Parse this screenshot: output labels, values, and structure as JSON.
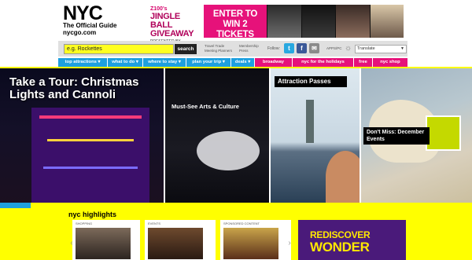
{
  "header": {
    "logo_text": "NYC",
    "logo_subtitle": "The Official Guide",
    "logo_site": "nycgo.com",
    "banner": {
      "station": "Z100's",
      "event_title": "JINGLE BALL GIVEAWAY",
      "presented_by": "PRESENTED BY",
      "cta": "ENTER TO WIN 2 TICKETS"
    }
  },
  "search": {
    "value": "e.g. Rockettes",
    "button_label": "search"
  },
  "top_links": [
    {
      "label": "Travel Trade"
    },
    {
      "label": "Meeting Planners"
    },
    {
      "label": "Membership"
    },
    {
      "label": "Press"
    }
  ],
  "social": {
    "follow_label": "Follow:",
    "twitter": "t",
    "facebook": "f",
    "email": "✉"
  },
  "apps_label": "APPS/PC",
  "translate": {
    "label": "Translate"
  },
  "nav": [
    {
      "label": "top attractions",
      "dropdown": true
    },
    {
      "label": "what to do",
      "dropdown": true
    },
    {
      "label": "where to stay",
      "dropdown": true
    },
    {
      "label": "plan your trip",
      "dropdown": true
    },
    {
      "label": "deals",
      "dropdown": true
    },
    {
      "label": "broadway",
      "dropdown": false
    },
    {
      "label": "nyc for the holidays",
      "dropdown": false
    },
    {
      "label": "free",
      "dropdown": false
    },
    {
      "label": "nyc shop",
      "dropdown": false
    }
  ],
  "hero": [
    {
      "title": "Take a Tour: Christmas Lights and Cannoli"
    },
    {
      "title": "Must-See Arts & Culture"
    },
    {
      "title": "Attraction Passes"
    },
    {
      "title": "Don't Miss: December Events"
    }
  ],
  "carousel_progress": 0.065,
  "highlights": {
    "title": "nyc highlights",
    "cards": [
      {
        "label": "SHOPPING"
      },
      {
        "label": "EVENTS"
      },
      {
        "label": "SPONSORED CONTENT"
      }
    ],
    "promo": {
      "line1": "REDISCOVER",
      "line2": "WONDER"
    }
  },
  "colors": {
    "nav_blue": "#1ea0df",
    "pink": "#e6127a",
    "yellow": "#ffff00"
  }
}
